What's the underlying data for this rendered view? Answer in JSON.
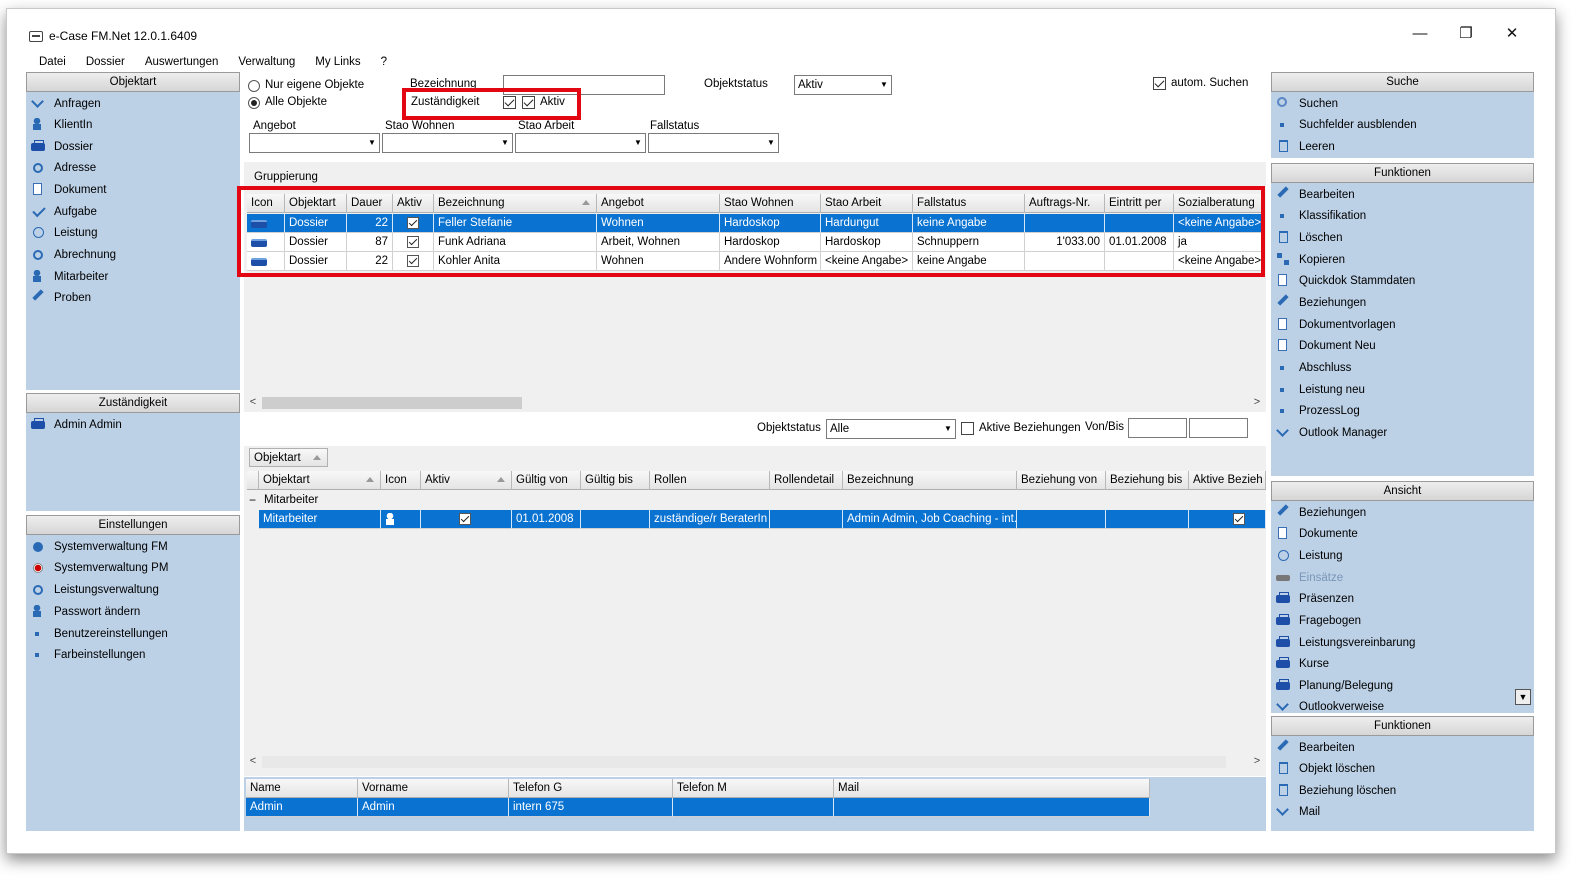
{
  "window": {
    "title": "e-Case FM.Net 12.0.1.6409",
    "minimize_icon": "minimize-icon",
    "maximize_icon": "restore-icon",
    "close_icon": "close-icon"
  },
  "menu": [
    "Datei",
    "Dossier",
    "Auswertungen",
    "Verwaltung",
    "My Links",
    "?"
  ],
  "left": {
    "objektart_title": "Objektart",
    "objektart_items": [
      "Anfragen",
      "KlientIn",
      "Dossier",
      "Adresse",
      "Dokument",
      "Aufgabe",
      "Leistung",
      "Abrechnung",
      "Mitarbeiter",
      "Proben"
    ],
    "zust_title": "Zuständigkeit",
    "zust_items": [
      "Admin Admin"
    ],
    "einst_title": "Einstellungen",
    "einst_items": [
      "Systemverwaltung FM",
      "Systemverwaltung PM",
      "Leistungsverwaltung",
      "Passwort ändern",
      "Benutzereinstellungen",
      "Farbeinstellungen"
    ]
  },
  "filter": {
    "nur_eigene": "Nur eigene Objekte",
    "alle": "Alle Objekte",
    "bezeichnung_label": "Bezeichnung",
    "bezeichnung_value": "",
    "zustaendigkeit": "Zuständigkeit",
    "aktiv": "Aktiv",
    "objektstatus_label": "Objektstatus",
    "objektstatus_value": "Aktiv",
    "autom_suchen": "autom. Suchen",
    "angebot": "Angebot",
    "stao_wohnen": "Stao Wohnen",
    "stao_arbeit": "Stao Arbeit",
    "fallstatus": "Fallstatus",
    "gruppierung": "Gruppierung"
  },
  "main_grid": {
    "columns": [
      "Icon",
      "Objektart",
      "Dauer",
      "Aktiv",
      "Bezeichnung",
      "Angebot",
      "Stao Wohnen",
      "Stao Arbeit",
      "Fallstatus",
      "Auftrags-Nr.",
      "Eintritt per",
      "Sozialberatung"
    ],
    "rows": [
      {
        "objektart": "Dossier",
        "dauer": "22",
        "aktiv": true,
        "bezeichnung": "Feller Stefanie",
        "angebot": "Wohnen",
        "stao_wohnen": "Hardoskop",
        "stao_arbeit": "Hardungut",
        "fallstatus": "keine Angabe",
        "auftrag": "",
        "eintritt": "",
        "sozial": "<keine Angabe>"
      },
      {
        "objektart": "Dossier",
        "dauer": "87",
        "aktiv": true,
        "bezeichnung": "Funk Adriana",
        "angebot": "Arbeit, Wohnen",
        "stao_wohnen": "Hardoskop",
        "stao_arbeit": "Hardoskop",
        "fallstatus": "Schnuppern",
        "auftrag": "1'033.00",
        "eintritt": "01.01.2008",
        "sozial": "ja"
      },
      {
        "objektart": "Dossier",
        "dauer": "22",
        "aktiv": true,
        "bezeichnung": "Kohler Anita",
        "angebot": "Wohnen",
        "stao_wohnen": "Andere Wohnform",
        "stao_arbeit": "<keine Angabe>",
        "fallstatus": "keine Angabe",
        "auftrag": "",
        "eintritt": "",
        "sozial": "<keine Angabe>"
      }
    ]
  },
  "rel": {
    "objektstatus_label": "Objektstatus",
    "objektstatus_value": "Alle",
    "aktive_bez": "Aktive Beziehungen",
    "vonbis": "Von/Bis",
    "group_chip": "Objektart",
    "columns": [
      "Objektart",
      "Icon",
      "Aktiv",
      "Gültig von",
      "Gültig bis",
      "Rollen",
      "Rollendetail",
      "Bezeichnung",
      "Beziehung von",
      "Beziehung bis",
      "Aktive Bezieh"
    ],
    "group_label": "Mitarbeiter",
    "row": {
      "objektart": "Mitarbeiter",
      "gueltig_von": "01.01.2008",
      "rollen": "zuständige/r BeraterIn",
      "bezeichnung": "Admin Admin,  Job Coaching - int..."
    }
  },
  "contact": {
    "columns": [
      "Name",
      "Vorname",
      "Telefon G",
      "Telefon M",
      "Mail"
    ],
    "row": [
      "Admin",
      "Admin",
      "intern 675",
      "",
      ""
    ]
  },
  "right": {
    "suche_title": "Suche",
    "suche_items": [
      "Suchen",
      "Suchfelder ausblenden",
      "Leeren"
    ],
    "funk_title": "Funktionen",
    "funk_items": [
      "Bearbeiten",
      "Klassifikation",
      "Löschen",
      "Kopieren",
      "Quickdok Stammdaten",
      "Beziehungen",
      "Dokumentvorlagen",
      "Dokument Neu",
      "Abschluss",
      "Leistung neu",
      "ProzessLog",
      "Outlook Manager"
    ],
    "ansicht_title": "Ansicht",
    "ansicht_items": [
      "Beziehungen",
      "Dokumente",
      "Leistung",
      "Einsätze",
      "Präsenzen",
      "Fragebogen",
      "Leistungsvereinbarung",
      "Kurse",
      "Planung/Belegung",
      "Outlookverweise"
    ],
    "funk2_title": "Funktionen",
    "funk2_items": [
      "Bearbeiten",
      "Objekt löschen",
      "Beziehung löschen",
      "Mail"
    ]
  },
  "colors": {
    "selection": "#0a73d2",
    "panel": "#bcd0e6",
    "highlight": "#e30613"
  }
}
